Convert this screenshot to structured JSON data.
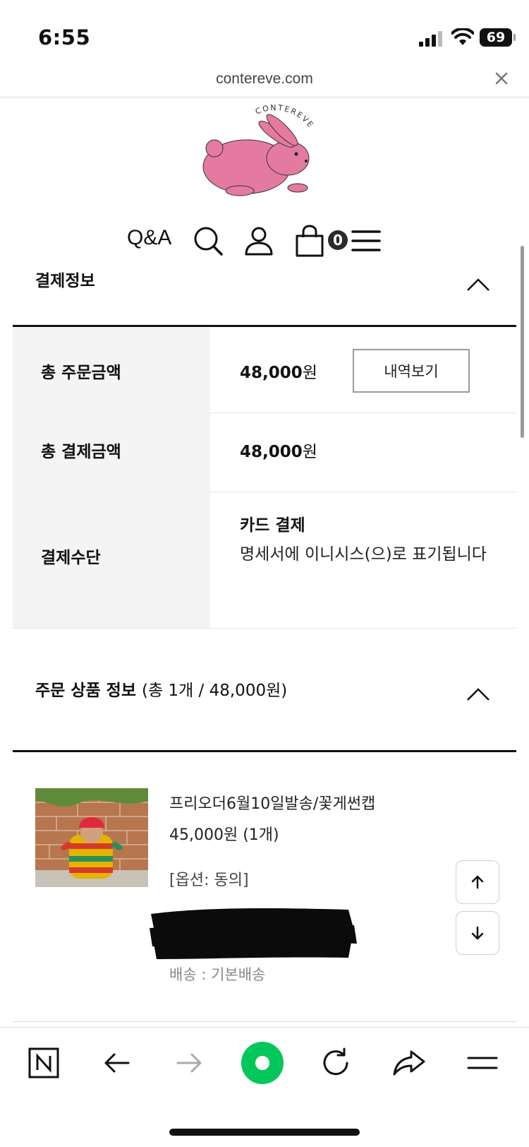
{
  "status_bar": {
    "time": "6:55",
    "battery": "69",
    "icons": [
      "signal-icon",
      "wifi-icon",
      "battery-icon"
    ]
  },
  "browser": {
    "url": "contereve.com",
    "close_icon": "close-icon"
  },
  "site_header": {
    "logo_text": "CONTEREVE",
    "nav": {
      "qa_label": "Q&A",
      "cart_count": "0",
      "icons": [
        "search-icon",
        "user-icon",
        "cart-icon",
        "menu-icon"
      ]
    }
  },
  "payment_section": {
    "title": "결제정보",
    "rows": [
      {
        "label": "총 주문금액",
        "amount": "48,000",
        "unit": "원",
        "button": "내역보기"
      },
      {
        "label": "총 결제금액",
        "amount": "48,000",
        "unit": "원"
      },
      {
        "label": "결제수단",
        "method": "카드 결제",
        "note": "명세서에 이니시스(으)로 표기됩니다"
      }
    ]
  },
  "order_section": {
    "title": "주문 상품 정보",
    "summary": "(총 1개 / 48,000원)",
    "items": [
      {
        "name": "프리오더6월10일발송/꽃게썬캡",
        "price": "45,000원 (1개)",
        "option": "[옵션: 동의]",
        "shipping": "배송 : 기본배송"
      }
    ]
  },
  "bottom_toolbar": {
    "icons": [
      "naver-n-icon",
      "back-arrow-icon",
      "forward-arrow-icon",
      "green-dot-icon",
      "refresh-icon",
      "share-icon",
      "menu-icon"
    ]
  },
  "colors": {
    "label_bg": "#f4f4f4",
    "rule": "#111111",
    "logo_pink": "#e57aa0",
    "naver_green": "#03c75a"
  }
}
